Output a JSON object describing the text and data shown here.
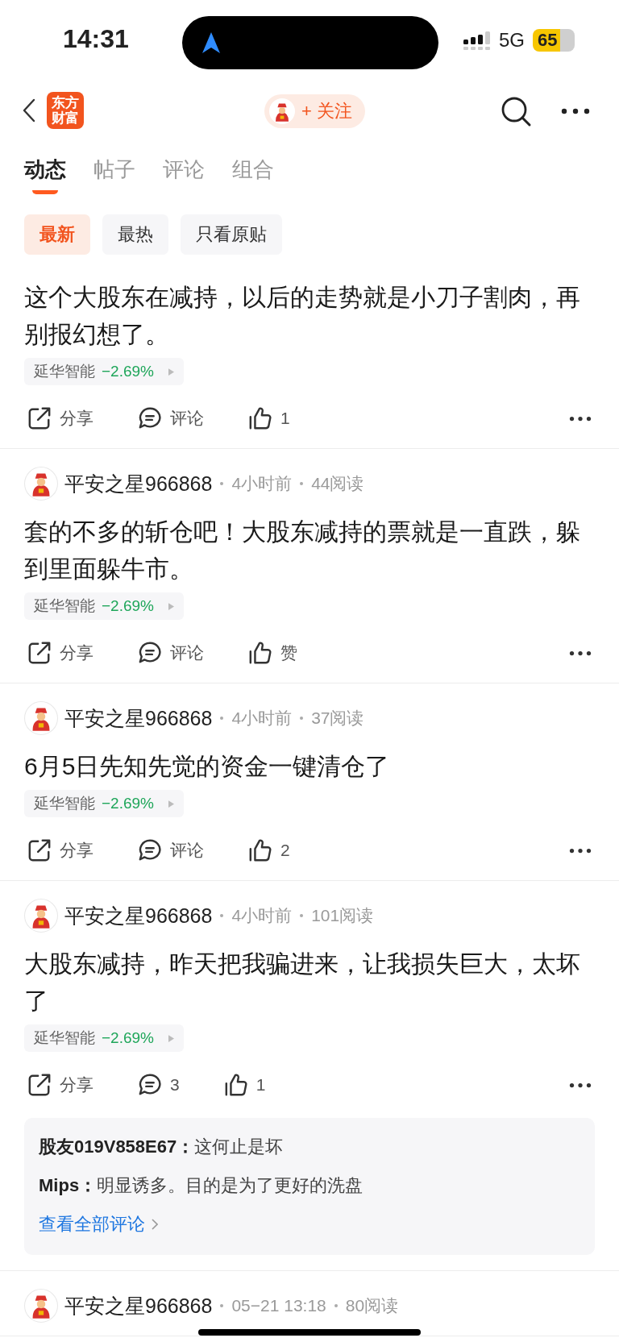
{
  "status_bar": {
    "time": "14:31",
    "network": "5G",
    "battery": "65"
  },
  "header": {
    "logo": [
      "东方",
      "财富"
    ],
    "follow_label": "+ 关注"
  },
  "tabs": [
    {
      "label": "动态",
      "selected": true
    },
    {
      "label": "帖子",
      "selected": false
    },
    {
      "label": "评论",
      "selected": false
    },
    {
      "label": "组合",
      "selected": false
    }
  ],
  "filters": [
    {
      "label": "最新",
      "selected": true
    },
    {
      "label": "最热",
      "selected": false
    },
    {
      "label": "只看原贴",
      "selected": false
    }
  ],
  "posts": [
    {
      "text": "这个大股东在减持，以后的走势就是小刀子割肉，再别报幻想了。",
      "stock": {
        "name": "延华智能",
        "change": "−2.69%"
      },
      "share": "分享",
      "comment": "评论",
      "like": "1"
    },
    {
      "author": "平安之星966868",
      "time": "4小时前",
      "reads": "44阅读",
      "text": "套的不多的斩仓吧！大股东减持的票就是一直跌，躲到里面躲牛市。",
      "stock": {
        "name": "延华智能",
        "change": "−2.69%"
      },
      "share": "分享",
      "comment": "评论",
      "like": "赞"
    },
    {
      "author": "平安之星966868",
      "time": "4小时前",
      "reads": "37阅读",
      "text": "6月5日先知先觉的资金一键清仓了",
      "stock": {
        "name": "延华智能",
        "change": "−2.69%"
      },
      "share": "分享",
      "comment": "评论",
      "like": "2"
    },
    {
      "author": "平安之星966868",
      "time": "4小时前",
      "reads": "101阅读",
      "text": "大股东减持，昨天把我骗进来，让我损失巨大，太坏了",
      "stock": {
        "name": "延华智能",
        "change": "−2.69%"
      },
      "share": "分享",
      "comment": "3",
      "like": "1",
      "comments": [
        "**股友019V858E67：**这何止是坏",
        "**Mips：**明显诱多。目的是为了更好的洗盘"
      ],
      "view_all": "查看全部评论"
    },
    {
      "author": "平安之星966868",
      "time": "05−21 13:18",
      "reads": "80阅读"
    }
  ]
}
